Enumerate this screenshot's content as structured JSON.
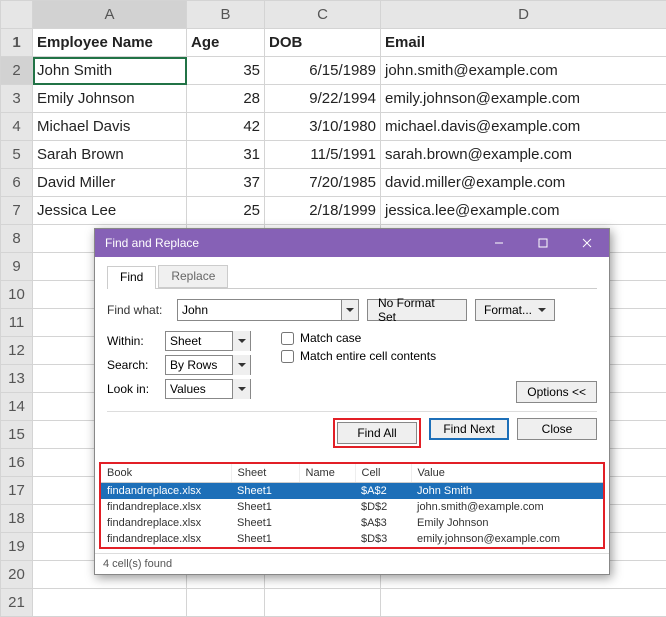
{
  "columns": [
    "A",
    "B",
    "C",
    "D"
  ],
  "rowCount": 21,
  "headers": {
    "A": "Employee Name",
    "B": "Age",
    "C": "DOB",
    "D": "Email"
  },
  "rows": [
    {
      "A": "John Smith",
      "B": "35",
      "C": "6/15/1989",
      "D": "john.smith@example.com"
    },
    {
      "A": "Emily Johnson",
      "B": "28",
      "C": "9/22/1994",
      "D": "emily.johnson@example.com"
    },
    {
      "A": "Michael Davis",
      "B": "42",
      "C": "3/10/1980",
      "D": "michael.davis@example.com"
    },
    {
      "A": "Sarah Brown",
      "B": "31",
      "C": "11/5/1991",
      "D": "sarah.brown@example.com"
    },
    {
      "A": "David Miller",
      "B": "37",
      "C": "7/20/1985",
      "D": "david.miller@example.com"
    },
    {
      "A": "Jessica Lee",
      "B": "25",
      "C": "2/18/1999",
      "D": "jessica.lee@example.com"
    }
  ],
  "selection": {
    "col": "A",
    "row": 2
  },
  "dialog": {
    "title": "Find and Replace",
    "tabs": {
      "find": "Find",
      "replace": "Replace"
    },
    "find_what_label": "Find what:",
    "find_what_value": "John",
    "no_format": "No Format Set",
    "format_btn": "Format...",
    "within_label": "Within:",
    "within_value": "Sheet",
    "search_label": "Search:",
    "search_value": "By Rows",
    "lookin_label": "Look in:",
    "lookin_value": "Values",
    "match_case": "Match case",
    "match_entire": "Match entire cell contents",
    "options_btn": "Options <<",
    "find_all": "Find All",
    "find_next": "Find Next",
    "close": "Close",
    "results_headers": {
      "book": "Book",
      "sheet": "Sheet",
      "name": "Name",
      "cell": "Cell",
      "value": "Value"
    },
    "results": [
      {
        "book": "findandreplace.xlsx",
        "sheet": "Sheet1",
        "name": "",
        "cell": "$A$2",
        "value": "John Smith",
        "selected": true
      },
      {
        "book": "findandreplace.xlsx",
        "sheet": "Sheet1",
        "name": "",
        "cell": "$D$2",
        "value": "john.smith@example.com"
      },
      {
        "book": "findandreplace.xlsx",
        "sheet": "Sheet1",
        "name": "",
        "cell": "$A$3",
        "value": "Emily Johnson"
      },
      {
        "book": "findandreplace.xlsx",
        "sheet": "Sheet1",
        "name": "",
        "cell": "$D$3",
        "value": "emily.johnson@example.com"
      }
    ],
    "status": "4 cell(s) found"
  }
}
